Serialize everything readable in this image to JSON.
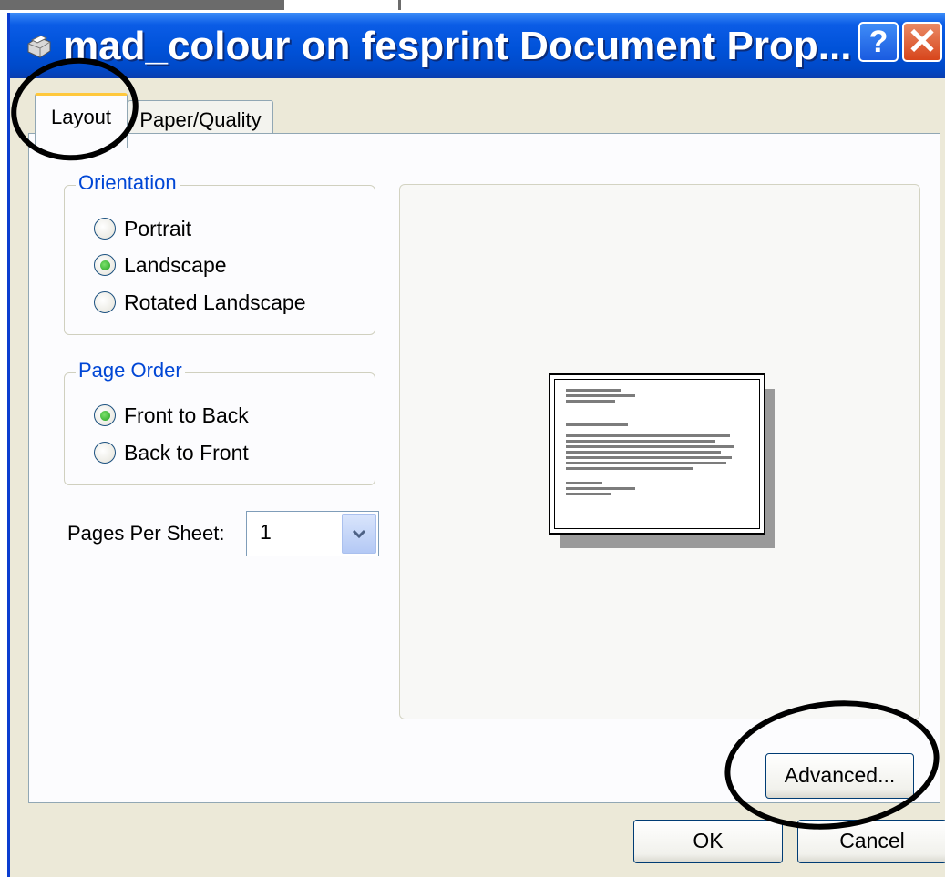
{
  "window": {
    "title": "mad_colour on fesprint Document Prop...",
    "help_label": "?",
    "close_label": "✕"
  },
  "tabs": [
    {
      "label": "Layout",
      "active": true
    },
    {
      "label": "Paper/Quality",
      "active": false
    }
  ],
  "orientation": {
    "legend": "Orientation",
    "options": [
      {
        "label": "Portrait",
        "selected": false
      },
      {
        "label": "Landscape",
        "selected": true
      },
      {
        "label": "Rotated Landscape",
        "selected": false
      }
    ]
  },
  "page_order": {
    "legend": "Page Order",
    "options": [
      {
        "label": "Front to Back",
        "selected": true
      },
      {
        "label": "Back to Front",
        "selected": false
      }
    ]
  },
  "pages_per_sheet": {
    "label": "Pages Per Sheet:",
    "value": "1"
  },
  "buttons": {
    "advanced": "Advanced...",
    "ok": "OK",
    "cancel": "Cancel"
  },
  "colors": {
    "titlebar": "#0052d9",
    "legend_text": "#0046d5",
    "dialog_bg": "#ece9d8",
    "annotation": "#000000"
  }
}
